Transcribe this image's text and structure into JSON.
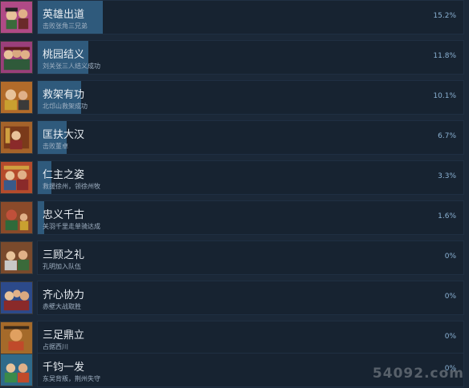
{
  "achievements": [
    {
      "title": "英雄出道",
      "desc": "击败张角三兄弟",
      "percent": "15.2%",
      "value": 15.2,
      "icon": "achievement-hero-debut-icon",
      "icon_bg": "#b04a86"
    },
    {
      "title": "桃园结义",
      "desc": "刘关张三人结义成功",
      "percent": "11.8%",
      "value": 11.8,
      "icon": "achievement-peach-garden-oath-icon",
      "icon_bg": "#9a3f7a"
    },
    {
      "title": "救架有功",
      "desc": "北邙山救架成功",
      "percent": "10.1%",
      "value": 10.1,
      "icon": "achievement-rescue-emperor-icon",
      "icon_bg": "#b26b2a"
    },
    {
      "title": "匡扶大汉",
      "desc": "击败董卓",
      "percent": "6.7%",
      "value": 6.7,
      "icon": "achievement-restore-han-icon",
      "icon_bg": "#a5632a"
    },
    {
      "title": "仁主之姿",
      "desc": "救援徐州，领徐州牧",
      "percent": "3.3%",
      "value": 3.3,
      "icon": "achievement-benevolent-lord-icon",
      "icon_bg": "#b54b2c"
    },
    {
      "title": "忠义千古",
      "desc": "关羽千里走单骑达成",
      "percent": "1.6%",
      "value": 1.6,
      "icon": "achievement-eternal-loyalty-icon",
      "icon_bg": "#8b4a2a"
    },
    {
      "title": "三顾之礼",
      "desc": "孔明加入队伍",
      "percent": "0%",
      "value": 0,
      "icon": "achievement-three-visits-icon",
      "icon_bg": "#7a4a2c"
    },
    {
      "title": "齐心协力",
      "desc": "赤壁大战取胜",
      "percent": "0%",
      "value": 0,
      "icon": "achievement-united-effort-icon",
      "icon_bg": "#2c4a8a"
    },
    {
      "title": "三足鼎立",
      "desc": "占据西川",
      "percent": "0%",
      "value": 0,
      "icon": "achievement-three-kingdoms-icon",
      "icon_bg": "#a56a2a"
    },
    {
      "title": "千钧一发",
      "desc": "东吴背叛，荆州失守",
      "percent": "0%",
      "value": 0,
      "icon": "achievement-close-call-icon",
      "icon_bg": "#2f6a8a"
    }
  ],
  "watermark": "54092.com",
  "colors": {
    "background": "#1b2838",
    "bar_fill": "#2f5a7c",
    "percent_text": "#8ab1d3"
  }
}
